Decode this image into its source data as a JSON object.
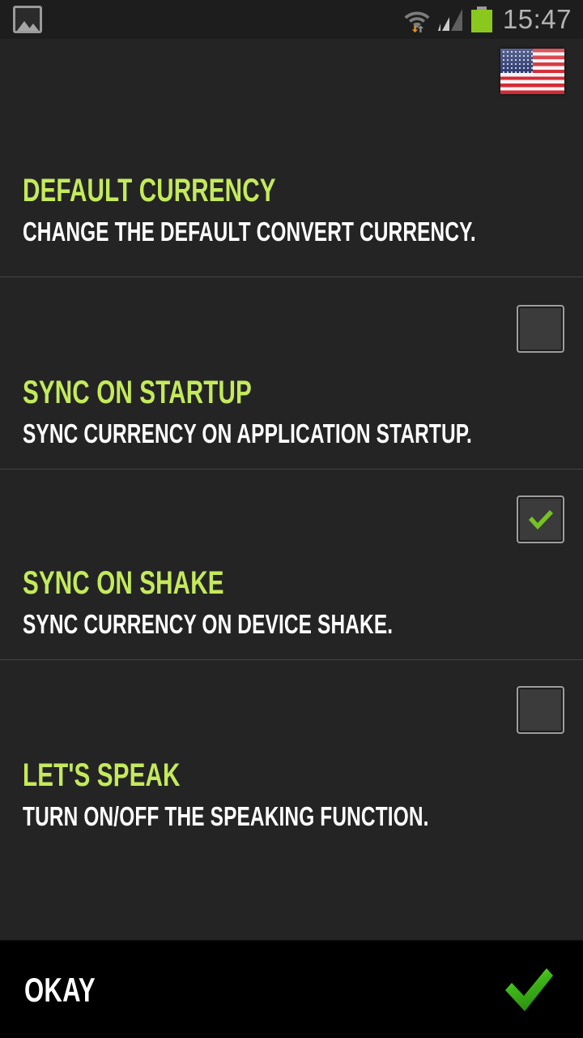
{
  "status_bar": {
    "left_icon": "gallery-image-icon",
    "icons": [
      "wifi-icon",
      "cellular-signal-icon",
      "battery-icon"
    ],
    "wifi_download_indicator": "down-arrow-icon",
    "wifi_upload_indicator": "up-arrow-icon",
    "time": "15:47",
    "time_color": "#b3b3b3",
    "battery_color": "#8ac81e"
  },
  "header": {
    "flag_icon": "us-flag-icon",
    "flag_alt": "United States flag"
  },
  "theme": {
    "background": "#242424",
    "accent": "#c4ea5b",
    "text": "#ffffff",
    "divider": "#454545",
    "check_green": "#76c322",
    "bottom_bar_background": "#000000"
  },
  "settings": [
    {
      "id": "default-currency",
      "title": "DEFAULT CURRENCY",
      "subtitle": "CHANGE THE DEFAULT CONVERT CURRENCY.",
      "has_checkbox": false,
      "checked": false
    },
    {
      "id": "sync-on-startup",
      "title": "SYNC ON STARTUP",
      "subtitle": "SYNC CURRENCY ON APPLICATION STARTUP.",
      "has_checkbox": true,
      "checked": false
    },
    {
      "id": "sync-on-shake",
      "title": "SYNC ON SHAKE",
      "subtitle": "SYNC CURRENCY ON DEVICE SHAKE.",
      "has_checkbox": true,
      "checked": true
    },
    {
      "id": "lets-speak",
      "title": "LET'S SPEAK",
      "subtitle": "TURN ON/OFF THE SPEAKING FUNCTION.",
      "has_checkbox": true,
      "checked": false
    }
  ],
  "bottom_bar": {
    "confirm_label": "OKAY",
    "confirm_icon": "green-checkmark-icon"
  }
}
